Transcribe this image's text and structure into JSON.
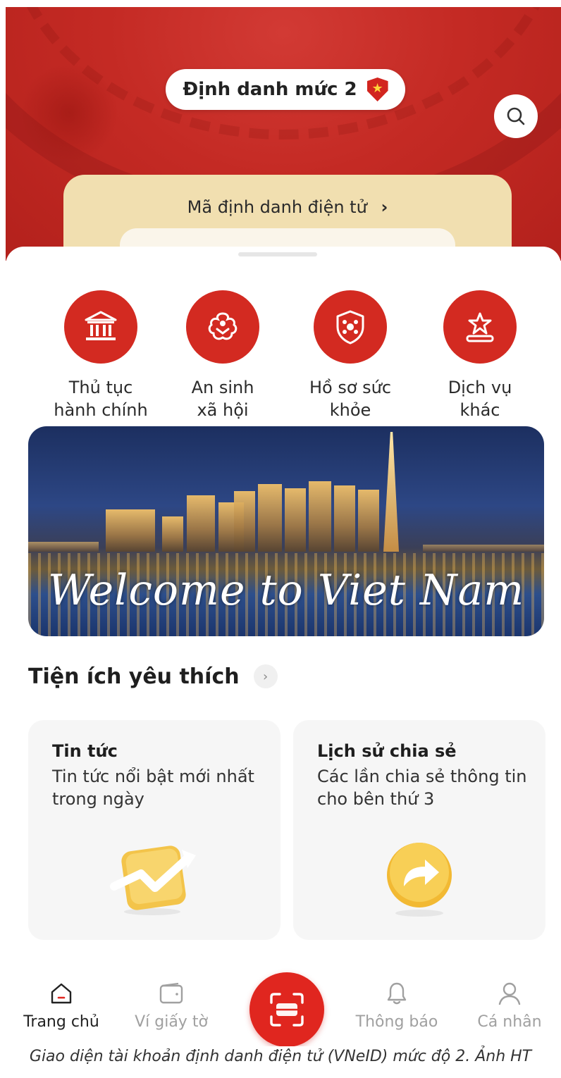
{
  "header": {
    "level_label": "Định danh mức 2",
    "eid_link": "Mã định danh điện tử",
    "chevron": "›"
  },
  "services": [
    {
      "icon": "government-building-icon",
      "label": "Thủ tục\nhành chính"
    },
    {
      "icon": "social-welfare-icon",
      "label": "An sinh\nxã hội"
    },
    {
      "icon": "health-record-icon",
      "label": "Hồ sơ sức\nkhỏe"
    },
    {
      "icon": "other-services-icon",
      "label": "Dịch vụ\nkhác"
    }
  ],
  "banner": {
    "text": "Welcome to Viet Nam"
  },
  "favorites": {
    "title": "Tiện ích yêu thích",
    "tiles": [
      {
        "title": "Tin tức",
        "desc": "Tin tức nổi bật mới nhất trong ngày",
        "icon": "news-chart-icon"
      },
      {
        "title": "Lịch sử chia sẻ",
        "desc": "Các lần chia sẻ thông tin cho bên thứ 3",
        "icon": "share-arrow-icon"
      }
    ]
  },
  "nav": {
    "items": [
      {
        "label": "Trang chủ",
        "icon": "home-icon",
        "active": true
      },
      {
        "label": "Ví giấy tờ",
        "icon": "wallet-icon"
      },
      {
        "label": "Thông báo",
        "icon": "bell-icon"
      },
      {
        "label": "Cá nhân",
        "icon": "user-icon"
      }
    ]
  },
  "caption": "Giao diện tài khoản định danh điện tử (VNeID) mức độ 2. Ảnh HT",
  "colors": {
    "brand_red": "#d32a21",
    "card_gold": "#f1dfb0"
  }
}
